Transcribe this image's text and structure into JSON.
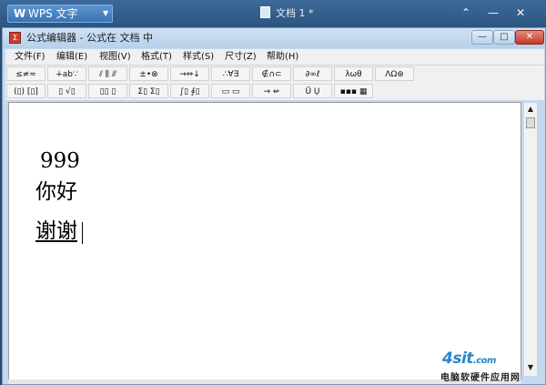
{
  "wps": {
    "logo": "W",
    "app_name": "WPS 文字",
    "menu_arrow": "▼",
    "doc_tab": "文档 1 *",
    "ctl_up": "⌃",
    "ctl_min": "—",
    "ctl_close": "✕"
  },
  "equation_window": {
    "icon": "Σ",
    "title": "公式编辑器 - 公式在 文档 中",
    "ctl_min": "—",
    "ctl_max": "□",
    "ctl_close": "✕"
  },
  "menubar": {
    "items": [
      "文件(F)",
      "编辑(E)",
      "视图(V)",
      "格式(T)",
      "样式(S)",
      "尺寸(Z)",
      "帮助(H)"
    ]
  },
  "palette_row_1": [
    "≤≠≈",
    "∔ab∵",
    "⫽ ⫼ ⫻",
    "±•⊗",
    "→⇔↓",
    "∴∀∃",
    "∉∩⊂",
    "∂∞ℓ",
    "λωθ",
    "ΛΩ⊛"
  ],
  "palette_row_2": [
    "(▯) [▯]",
    "▯ √▯",
    "▯▯ ▯",
    "Σ▯ Σ▯",
    "∫▯ ∮▯",
    "▭ ▭",
    "→ ↚",
    "Ū Ụ",
    "▪▪▪ ▦"
  ],
  "editor": {
    "lines": [
      "999",
      "你好",
      "谢谢"
    ]
  },
  "scrollbar": {
    "up": "▲",
    "down": "▼"
  },
  "watermark": {
    "logo": "4sit",
    "dotcom": ".com",
    "subtitle": "电脑软硬件应用网"
  }
}
